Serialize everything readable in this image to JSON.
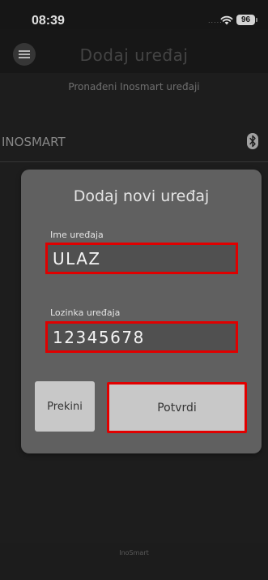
{
  "status_bar": {
    "time": "08:39",
    "signal_dots": ".....",
    "battery": "96"
  },
  "header": {
    "title": "Dodaj uređaj",
    "menu_icon": "hamburger-menu-icon"
  },
  "device_list": {
    "section_title": "Pronađeni Inosmart uređaji",
    "items": [
      {
        "name": "INOSMART",
        "icon": "bluetooth-icon"
      }
    ]
  },
  "dialog": {
    "title": "Dodaj novi uređaj",
    "name_field": {
      "label": "Ime uređaja",
      "value": "ULAZ"
    },
    "password_field": {
      "label": "Lozinka uređaja",
      "value": "12345678"
    },
    "cancel_label": "Prekini",
    "confirm_label": "Potvrdi",
    "highlight_color": "#e00000"
  },
  "footer": {
    "brand": "InoSmart"
  },
  "colors": {
    "background": "#222222",
    "dialog": "#606060",
    "button": "#c8c8c8"
  }
}
